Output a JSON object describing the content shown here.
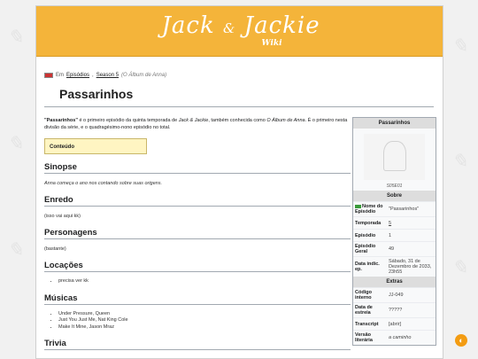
{
  "site": {
    "logo_main": "Jack",
    "logo_amp": "&",
    "logo_second": "Jackie",
    "logo_sub": "Wiki"
  },
  "breadcrumb": {
    "prefix": "Em",
    "link1": "Episódios",
    "sep": ",",
    "link2": "Season 5",
    "note": "(O Álbum de Anna)"
  },
  "page": {
    "title": "Passarinhos"
  },
  "intro": {
    "bold": "\"Passarinhos\"",
    "text1": " é o primeiro episódio da quinta temporada de ",
    "show": "Jack & Jackie",
    "text2": ", também conhecida como ",
    "alt": "O Álbum de Anna",
    "text3": ". É o primeiro nesta divisão da série, e o quadragésimo-nono episódio no total."
  },
  "toc": {
    "label": "Conteúdo"
  },
  "sections": {
    "sinopse": {
      "title": "Sinopse",
      "text": "Anna começa o ano nos contando sobre suas origens."
    },
    "enredo": {
      "title": "Enredo",
      "text": "(isso vai aqui kk)"
    },
    "personagens": {
      "title": "Personagens",
      "text": "(bastante)"
    },
    "locacoes": {
      "title": "Locações",
      "items": [
        "precisa ver kk"
      ]
    },
    "musicas": {
      "title": "Músicas",
      "items": [
        "Under Pressure, Queen",
        "Just You Just Me, Nat King Cole",
        "Make It Mine, Jason Mraz"
      ]
    },
    "trivia": {
      "title": "Trivia"
    }
  },
  "infobox": {
    "title": "Passarinhos",
    "caption": "S05E01",
    "section_about": "Sobre",
    "section_extras": "Extras",
    "rows_about": [
      {
        "k": "Nome do Episódio",
        "v": "\"Passarinhos\""
      },
      {
        "k": "Temporada",
        "v": "5"
      },
      {
        "k": "Episódio",
        "v": "1"
      },
      {
        "k": "Episódio Geral",
        "v": "49"
      },
      {
        "k": "Data indic. ep.",
        "v": "Sábado, 31 de Dezembro de 2033, 23h55"
      }
    ],
    "rows_extras": [
      {
        "k": "Código interno",
        "v": "JJ-049"
      },
      {
        "k": "Data de estreia",
        "v": "?????"
      },
      {
        "k": "Transcript",
        "v": "[abrir]"
      },
      {
        "k": "Versão literária",
        "v": "a caminho"
      }
    ]
  },
  "theme_toggle": {
    "icon": "◐"
  }
}
